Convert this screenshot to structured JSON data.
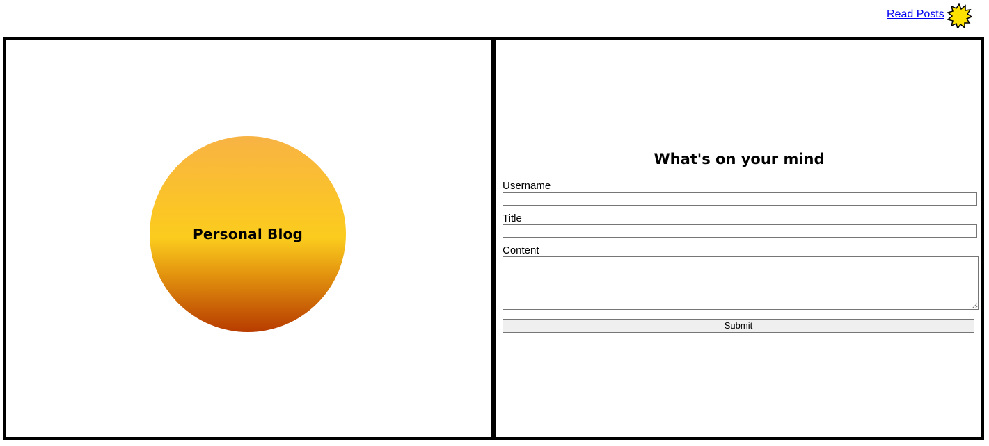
{
  "nav": {
    "read_posts_label": "Read Posts",
    "theme_icon": "sun-icon"
  },
  "hero": {
    "title": "Personal Blog",
    "colors": {
      "gradient_top": "#f8b344",
      "gradient_middle": "#fbcc1e",
      "gradient_bottom": "#b83c00"
    }
  },
  "form": {
    "heading": "What's on your mind",
    "username_label": "Username",
    "username_value": "",
    "title_label": "Title",
    "title_value": "",
    "content_label": "Content",
    "content_value": "",
    "submit_label": "Submit"
  }
}
